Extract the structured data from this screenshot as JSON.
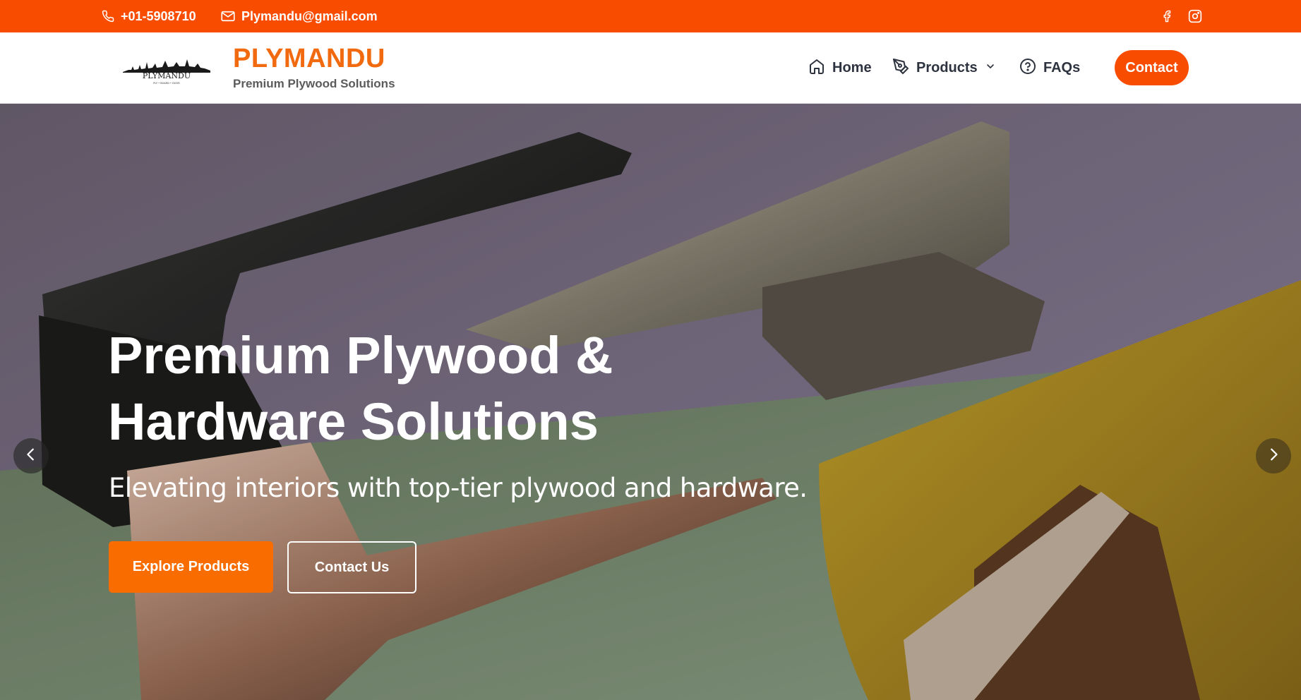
{
  "topbar": {
    "phone": "+01-5908710",
    "email": "Plymandu@gmail.com",
    "phone_icon": "phone-icon",
    "email_icon": "mail-icon",
    "social": [
      "facebook-icon",
      "instagram-icon"
    ],
    "bg_color": "#f84c00"
  },
  "header": {
    "brand_name": "PLYMANDU",
    "brand_tagline": "Premium Plywood Solutions",
    "logo_text": "PLYMANDU",
    "logo_subtext": "PLY • BOARD • DOOR",
    "brand_color": "#f26a10"
  },
  "nav": {
    "home": "Home",
    "products": "Products",
    "faqs": "FAQs",
    "contact": "Contact"
  },
  "hero": {
    "title_line1": "Premium Plywood &",
    "title_line2": "Hardware Solutions",
    "subtitle": "Elevating interiors with top-tier plywood and hardware.",
    "primary_button": "Explore Products",
    "secondary_button": "Contact Us",
    "accent_color": "#f86c00"
  }
}
